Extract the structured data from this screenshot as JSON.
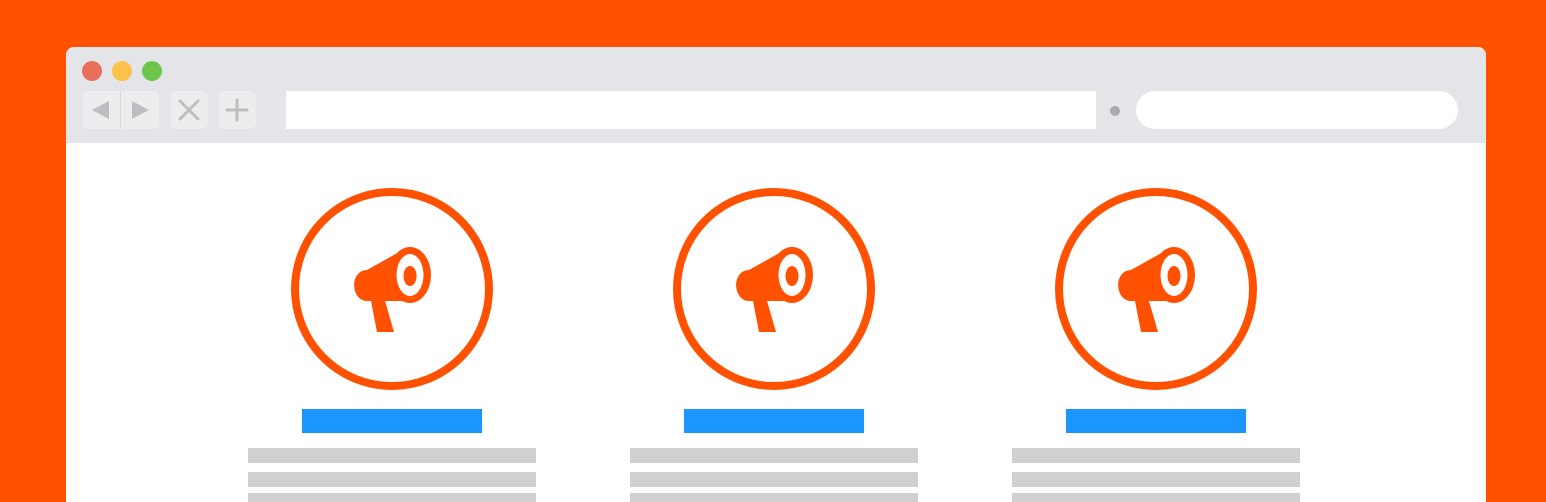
{
  "colors": {
    "background": "#ff5100",
    "accent": "#ff5100",
    "title_placeholder": "#1b95ff",
    "text_placeholder": "#d0d0d0",
    "chrome": "#e4e5e8"
  },
  "window": {
    "traffic_lights": [
      {
        "name": "close",
        "color": "#e8705b"
      },
      {
        "name": "minimize",
        "color": "#fcc24a"
      },
      {
        "name": "zoom",
        "color": "#6ec54c"
      }
    ]
  },
  "toolbar": {
    "back_icon": "triangle-left",
    "forward_icon": "triangle-right",
    "stop_icon": "x-mark",
    "new_tab_icon": "plus",
    "url_value": "",
    "search_value": ""
  },
  "features": [
    {
      "icon": "megaphone-icon",
      "title": "",
      "text_lines": 3
    },
    {
      "icon": "megaphone-icon",
      "title": "",
      "text_lines": 3
    },
    {
      "icon": "megaphone-icon",
      "title": "",
      "text_lines": 3
    }
  ]
}
